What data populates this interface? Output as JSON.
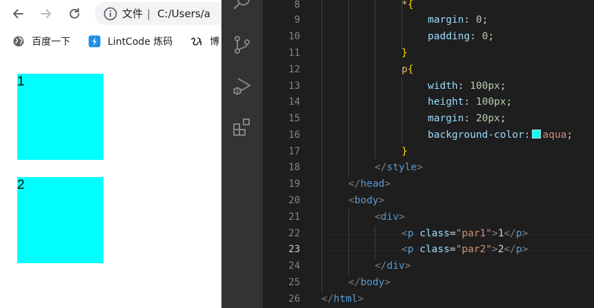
{
  "browser": {
    "omnibox": {
      "scheme": "文件",
      "separator": "|",
      "url": "C:/Users/a"
    },
    "bookmarks": [
      {
        "label": "百度一下"
      },
      {
        "label": "LintCode 炼码"
      },
      {
        "label": "博"
      }
    ],
    "page": {
      "paragraphs": [
        {
          "text": "1"
        },
        {
          "text": "2"
        }
      ],
      "box_color": "#00ffff"
    }
  },
  "editor": {
    "active_line": "23",
    "line_numbers": [
      "8",
      "9",
      "10",
      "11",
      "12",
      "13",
      "14",
      "15",
      "16",
      "17",
      "18",
      "19",
      "20",
      "21",
      "22",
      "23",
      "24",
      "25",
      "26"
    ],
    "code": {
      "l8": {
        "sel": "*",
        "brace": "{"
      },
      "l9": {
        "prop": "margin",
        "colon": ":",
        "num": "0",
        "semi": ";"
      },
      "l10": {
        "prop": "padding",
        "colon": ":",
        "num": "0",
        "semi": ";"
      },
      "l11": {
        "brace": "}"
      },
      "l12": {
        "sel": "p",
        "brace": "{"
      },
      "l13": {
        "prop": "width",
        "colon": ":",
        "num": "100px",
        "semi": ";"
      },
      "l14": {
        "prop": "height",
        "colon": ":",
        "num": "100px",
        "semi": ";"
      },
      "l15": {
        "prop": "margin",
        "colon": ":",
        "num": "20px",
        "semi": ";"
      },
      "l16": {
        "prop": "background-color",
        "colon": ":",
        "val": "aqua",
        "semi": ";"
      },
      "l17": {
        "brace": "}"
      },
      "l18": {
        "open": "</",
        "tag": "style",
        "close": ">"
      },
      "l19": {
        "open": "</",
        "tag": "head",
        "close": ">"
      },
      "l20": {
        "open": "<",
        "tag": "body",
        "close": ">"
      },
      "l21": {
        "open": "<",
        "tag": "div",
        "close": ">"
      },
      "l22": {
        "open": "<",
        "tag": "p",
        "attr": "class",
        "eq": "=",
        "str": "\"par1\"",
        "gt": ">",
        "text": "1",
        "cl_open": "</",
        "cl_tag": "p",
        "cl_close": ">"
      },
      "l23": {
        "open": "<",
        "tag": "p",
        "attr": "class",
        "eq": "=",
        "str": "\"par2\"",
        "gt": ">",
        "text": "2",
        "cl_open": "</",
        "cl_tag": "p",
        "cl_close": ">"
      },
      "l24": {
        "open": "</",
        "tag": "div",
        "close": ">"
      },
      "l25": {
        "open": "</",
        "tag": "body",
        "close": ">"
      },
      "l26": {
        "open": "</",
        "tag": "html",
        "close": ">"
      }
    }
  }
}
